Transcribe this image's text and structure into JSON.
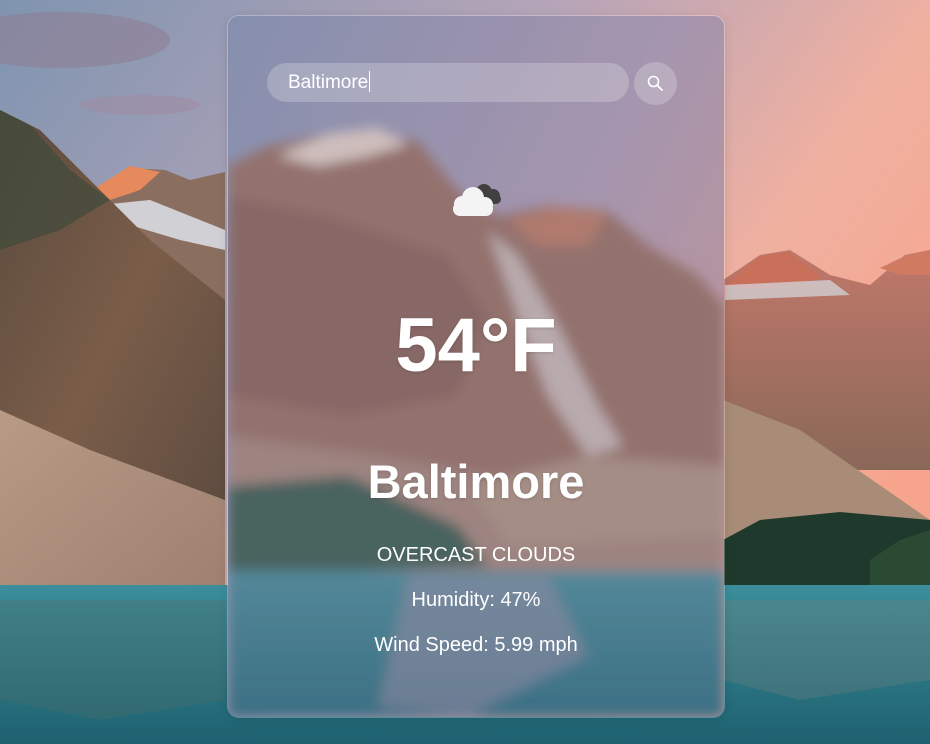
{
  "search": {
    "value": "Baltimore",
    "button_icon": "search-icon"
  },
  "weather": {
    "icon": "overcast-clouds-icon",
    "temperature": "54°F",
    "city": "Baltimore",
    "description": "OVERCAST CLOUDS",
    "humidity": "Humidity: 47%",
    "wind": "Wind Speed: 5.99 mph"
  },
  "background": {
    "scene": "mountain-lake-photo"
  },
  "colors": {
    "text": "#ffffff",
    "glass": "rgba(255,255,255,0.22)",
    "sky_pink": "#f4a090",
    "lake": "#2f7f8f"
  }
}
